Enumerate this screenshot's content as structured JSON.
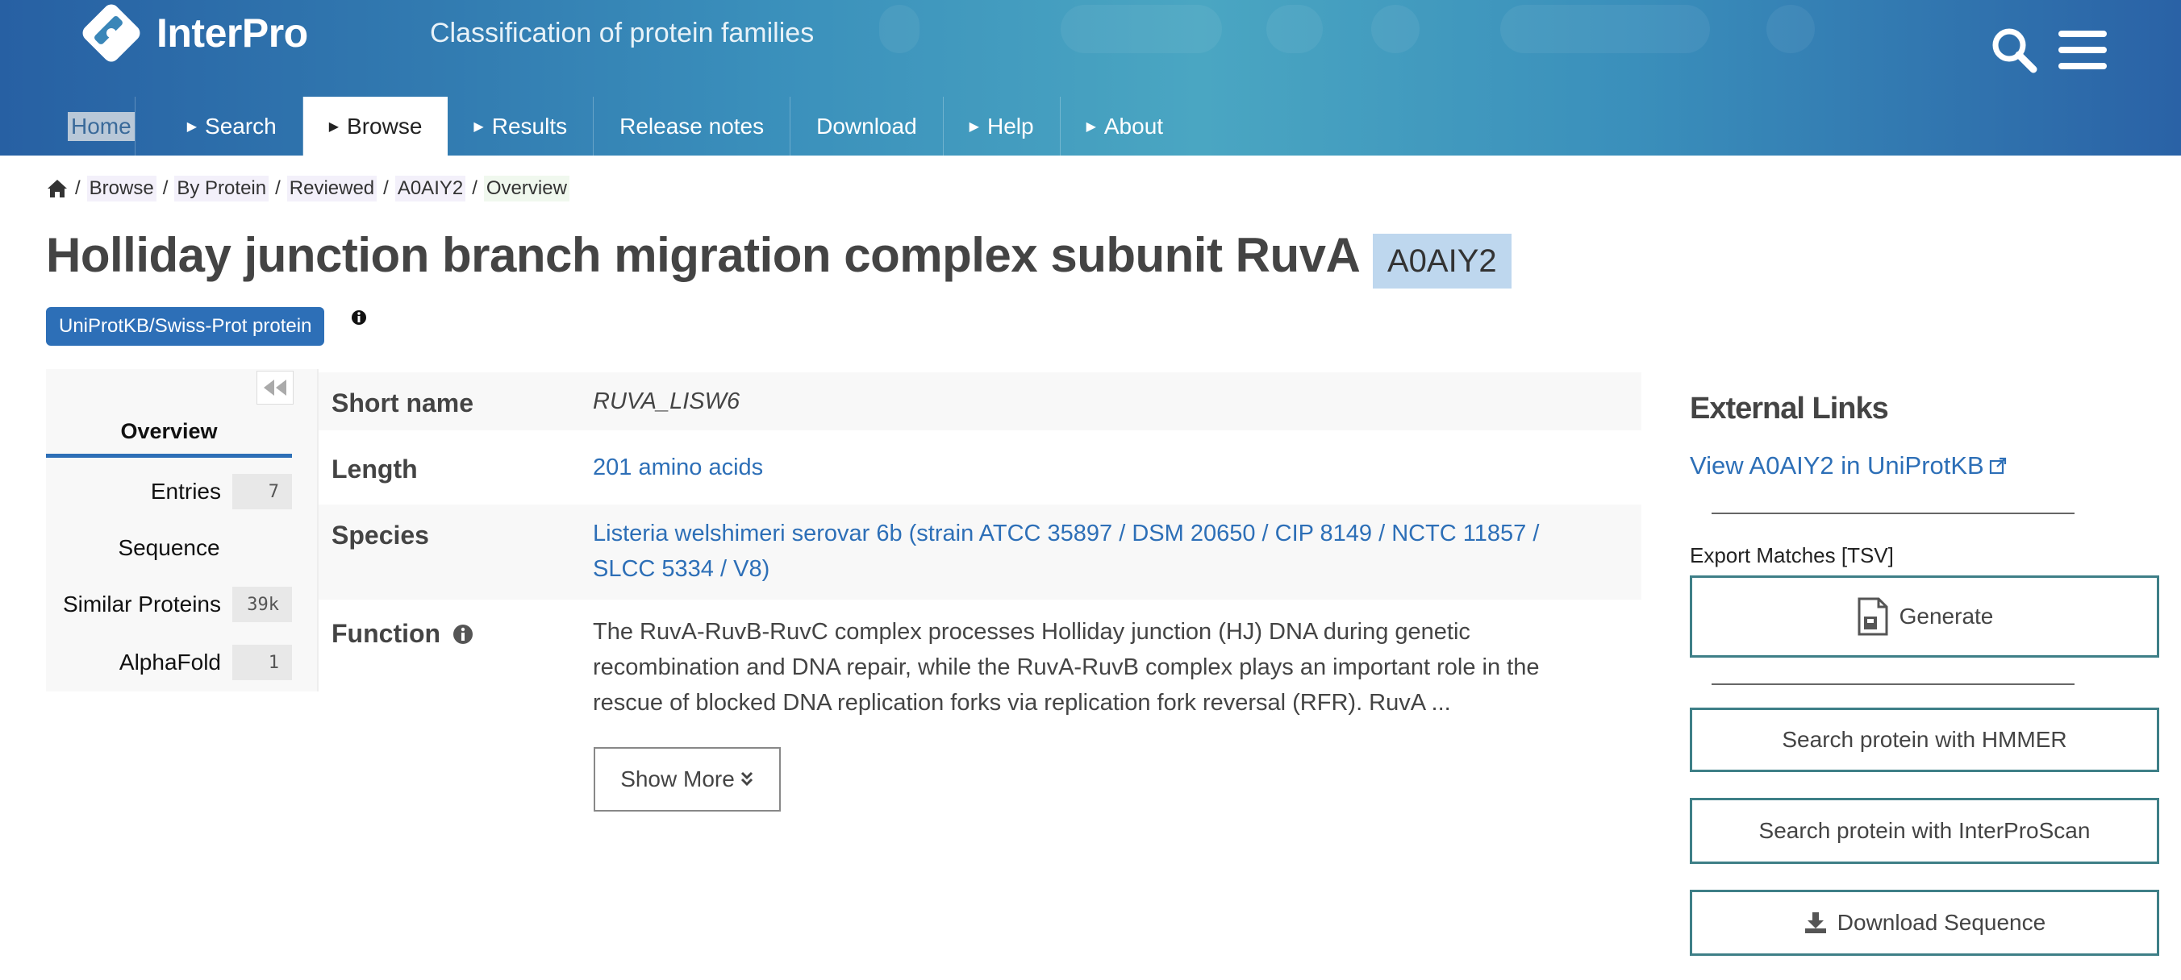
{
  "header": {
    "logo_text": "InterPro",
    "tagline": "Classification of protein families",
    "icons": {
      "search": "search-icon",
      "menu": "hamburger-menu-icon",
      "logo": "interpro-logo-icon"
    }
  },
  "nav": {
    "home": "Home",
    "search": "Search",
    "browse": "Browse",
    "results": "Results",
    "release_notes": "Release notes",
    "download": "Download",
    "help": "Help",
    "about": "About",
    "active": "Browse"
  },
  "breadcrumb": {
    "items": [
      "Browse",
      "By Protein",
      "Reviewed",
      "A0AIY2"
    ],
    "current": "Overview",
    "separator": "/"
  },
  "page": {
    "title": "Holliday junction branch migration complex subunit RuvA",
    "accession": "A0AIY2",
    "badge": "UniProtKB/Swiss-Prot protein"
  },
  "sidebar": {
    "active": "Overview",
    "items": [
      {
        "label": "Entries",
        "count": "7"
      },
      {
        "label": "Sequence"
      },
      {
        "label": "Similar Proteins",
        "count": "39k"
      },
      {
        "label": "AlphaFold",
        "count": "1"
      }
    ]
  },
  "details": {
    "short_name": {
      "label": "Short name",
      "value": "RUVA_LISW6"
    },
    "length": {
      "label": "Length",
      "value": "201 amino acids"
    },
    "species": {
      "label": "Species",
      "line1": "Listeria welshimeri serovar 6b (strain ATCC 35897 / DSM 20650 / CIP 8149 / NCTC 11857 /",
      "line2": "SLCC 5334 / V8)"
    },
    "function": {
      "label": "Function",
      "line1": "The RuvA-RuvB-RuvC complex processes Holliday junction (HJ) DNA during genetic",
      "line2": "recombination and DNA repair, while the RuvA-RuvB complex plays an important role in the",
      "line3": "rescue of blocked DNA replication forks via replication fork reversal (RFR). RuvA ...",
      "show_more": "Show More"
    }
  },
  "external": {
    "title": "External Links",
    "uniprot_link": "View A0AIY2 in UniProtKB",
    "export_label": "Export Matches [TSV]",
    "generate": "Generate",
    "hmmer": "Search protein with HMMER",
    "interproscan": "Search protein with InterProScan",
    "download_sequence": "Download Sequence"
  },
  "colors": {
    "header_dark": "#2760a3",
    "header_light": "#4aa6c2",
    "link": "#2d6fb7",
    "badge": "#2d6fb7",
    "accession_bg": "#bed7ee",
    "button_border": "#3e7f87"
  }
}
